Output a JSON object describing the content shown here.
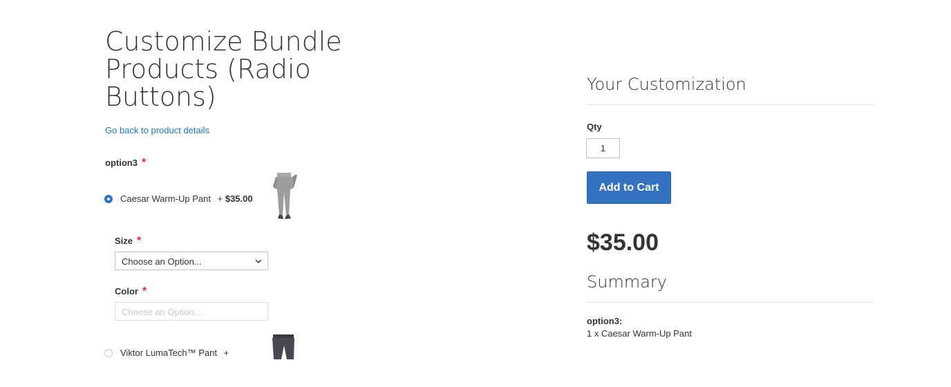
{
  "page": {
    "title": "Customize Bundle Products (Radio Buttons)",
    "back_link": "Go back to product details"
  },
  "option3": {
    "label": "option3",
    "required_mark": "*",
    "items": [
      {
        "name": "Caesar Warm-Up Pant",
        "price_prefix": "+",
        "price": "$35.00",
        "selected": true
      },
      {
        "name": "Viktor LumaTech™ Pant",
        "price_prefix": "+",
        "price": "",
        "selected": false
      }
    ],
    "size": {
      "label": "Size",
      "required_mark": "*",
      "value": "Choose an Option..."
    },
    "color": {
      "label": "Color",
      "required_mark": "*",
      "value": "Choose an Option..."
    }
  },
  "customization": {
    "title": "Your Customization",
    "qty_label": "Qty",
    "qty_value": "1",
    "add_to_cart": "Add to Cart",
    "price": "$35.00",
    "summary_title": "Summary",
    "summary_option": "option3:",
    "summary_line": "1 x Caesar Warm-Up Pant"
  },
  "colors": {
    "accent": "#1979c3",
    "button": "#3372c1",
    "required": "#e02b27"
  }
}
